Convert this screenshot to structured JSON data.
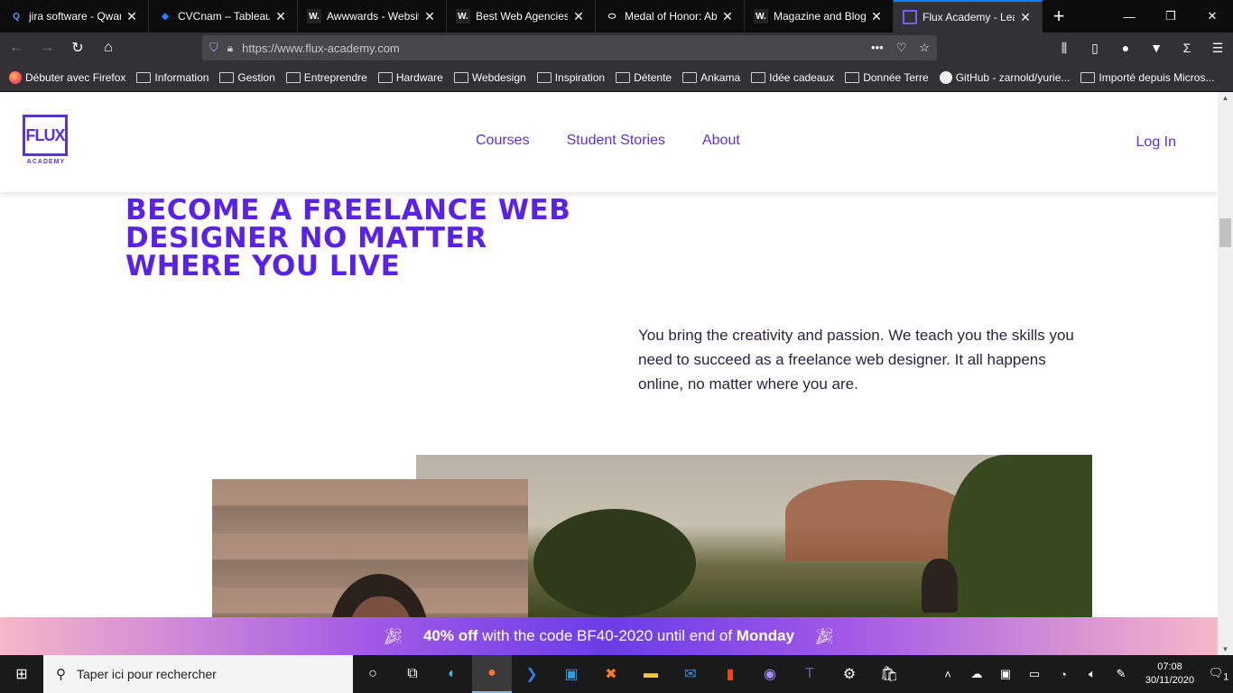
{
  "tabs": [
    {
      "title": "jira software - Qwant",
      "icon": "qwant-icon",
      "color": "#5c97ff",
      "glyph": "Q"
    },
    {
      "title": "CVCnam – Tableau - Jira",
      "icon": "jira-icon",
      "color": "#2684ff",
      "glyph": "◆"
    },
    {
      "title": "Awwwards - Website",
      "icon": "awwwards-icon",
      "color": "#222222",
      "glyph": "W."
    },
    {
      "title": "Best Web Agencies",
      "icon": "awwwards-icon",
      "color": "#222222",
      "glyph": "W."
    },
    {
      "title": "Medal of Honor: Above",
      "icon": "oculus-icon",
      "color": "#ffffff",
      "glyph": "⬭"
    },
    {
      "title": "Magazine and Blog",
      "icon": "awwwards-icon",
      "color": "#222222",
      "glyph": "W."
    },
    {
      "title": "Flux Academy - Learn",
      "icon": "flux-icon",
      "color": "#5a32dc",
      "glyph": "▢"
    }
  ],
  "url": "https://www.flux-academy.com",
  "bookmarks": [
    "Débuter avec Firefox",
    "Information",
    "Gestion",
    "Entreprendre",
    "Hardware",
    "Webdesign",
    "Inspiration",
    "Détente",
    "Ankama",
    "Idée cadeaux",
    "Donnée Terre",
    "GitHub - zarnold/yurie...",
    "Importé depuis Micros..."
  ],
  "site": {
    "logo_text": "FLUX",
    "logo_sub": "ACADEMY",
    "nav": [
      "Courses",
      "Student Stories",
      "About"
    ],
    "login": "Log In",
    "hero_title": "Become a freelance web designer no matter where you live",
    "hero_text": "You bring the creativity and passion. We teach you the skills you need to succeed as a freelance web designer. It all happens online, no matter where you are.",
    "promo": {
      "percent": "40% off",
      "middle": " with the code BF40-2020 until end of ",
      "day": "Monday"
    }
  },
  "taskbar": {
    "search_placeholder": "Taper ici pour rechercher",
    "time": "07:08",
    "date": "30/11/2020",
    "notif_count": "1"
  },
  "brand_color": "#5a32dc"
}
